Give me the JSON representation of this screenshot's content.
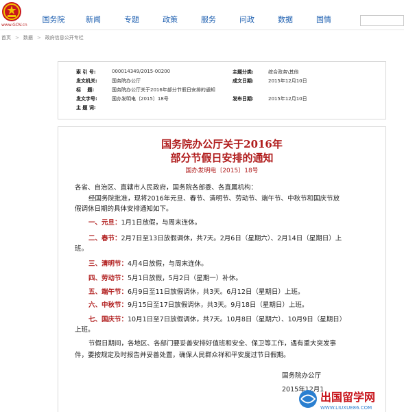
{
  "header": {
    "site_url": "www.GOV.cn",
    "nav": [
      "国务院",
      "新闻",
      "专题",
      "政策",
      "服务",
      "问政",
      "数据",
      "国情"
    ]
  },
  "breadcrumb": [
    "首页",
    "数据",
    "政府信息公开专栏"
  ],
  "meta": {
    "index_label": "索 引 号:",
    "index_value": "000014349/2015-00200",
    "category_label": "主题分类:",
    "category_value": "综合政务\\其他",
    "issuer_label": "发文机关:",
    "issuer_value": "国务院办公厅",
    "created_label": "成文日期:",
    "created_value": "2015年12月10日",
    "title_label": "标　 题:",
    "title_value": "国务院办公厅关于2016年部分节假日安排的通知",
    "docno_label": "发文字号:",
    "docno_value": "国办发明电〔2015〕18号",
    "published_label": "发布日期:",
    "published_value": "2015年12月10日",
    "subject_label": "主 题 词:",
    "subject_value": ""
  },
  "document": {
    "title_line1": "国务院办公厅关于2016年",
    "title_line2": "部分节假日安排的通知",
    "number": "国办发明电〔2015〕18号",
    "addressee": "各省、自治区、直辖市人民政府，国务院各部委、各直属机构：",
    "intro_line1": "经国务院批准，现将2016年元旦、春节、清明节、劳动节、端午节、中秋节和国庆节放",
    "intro_line2": "假调休日期的具体安排通知如下。",
    "items": [
      {
        "label": "一、元旦：",
        "text": "1月1日放假，与周末连休。"
      },
      {
        "label": "二、春节：",
        "text": "2月7日至13日放假调休，共7天。2月6日（星期六）、2月14日（星期日）上"
      },
      {
        "label": "",
        "text": "班。"
      },
      {
        "label": "三、清明节：",
        "text": "4月4日放假，与周末连休。"
      },
      {
        "label": "四、劳动节：",
        "text": "5月1日放假，5月2日（星期一）补休。"
      },
      {
        "label": "五、端午节：",
        "text": "6月9日至11日放假调休，共3天。6月12日（星期日）上班。"
      },
      {
        "label": "六、中秋节：",
        "text": "9月15日至17日放假调休，共3天。9月18日（星期日）上班。"
      },
      {
        "label": "七、国庆节：",
        "text": "10月1日至7日放假调休，共7天。10月8日（星期六）、10月9日（星期日）"
      },
      {
        "label": "",
        "text": "上班。"
      }
    ],
    "closing_line1": "节假日期间，各地区、各部门要妥善安排好值班和安全、保卫等工作，遇有重大突发事",
    "closing_line2": "件，要按规定及时报告并妥善处置，确保人民群众祥和平安度过节日假期。",
    "signature": "国务院办公厅",
    "date": "2015年12月1"
  },
  "watermark": {
    "text": "出国留学网",
    "url": "WWW.LIUXUE86.COM"
  },
  "colors": {
    "nav_blue": "#1d5fb0",
    "doc_red": "#b01c1c",
    "emblem_red": "#c8161d",
    "emblem_gold": "#f2c200"
  }
}
